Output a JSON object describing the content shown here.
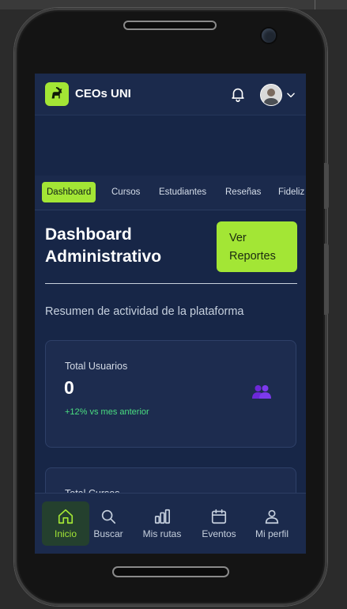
{
  "header": {
    "app_title": "CEOs UNI",
    "logo_icon": "goat-icon",
    "icons": [
      "bell-icon",
      "avatar",
      "chevron-down-icon"
    ]
  },
  "tabs": [
    {
      "label": "Dashboard",
      "active": true
    },
    {
      "label": "Cursos"
    },
    {
      "label": "Estudiantes"
    },
    {
      "label": "Reseñas"
    },
    {
      "label": "Fideliz"
    }
  ],
  "main": {
    "title": "Dashboard Administrativo",
    "report_button": "Ver Reportes",
    "subtitle": "Resumen de actividad de la plataforma",
    "cards": [
      {
        "label": "Total Usuarios",
        "value": "0",
        "trend": "+12% vs mes anterior",
        "icon": "users-icon"
      },
      {
        "label": "Total Cursos"
      }
    ]
  },
  "bottom_nav": [
    {
      "label": "Inicio",
      "icon": "home-icon",
      "active": true
    },
    {
      "label": "Buscar",
      "icon": "search-icon"
    },
    {
      "label": "Mis rutas",
      "icon": "bar-chart-icon"
    },
    {
      "label": "Eventos",
      "icon": "calendar-icon"
    },
    {
      "label": "Mi perfil",
      "icon": "user-icon"
    }
  ],
  "colors": {
    "accent": "#a3e635",
    "background": "#172647",
    "header": "#1b2a4c",
    "trend_positive": "#4ade80",
    "users_icon": "#7c3aed"
  }
}
